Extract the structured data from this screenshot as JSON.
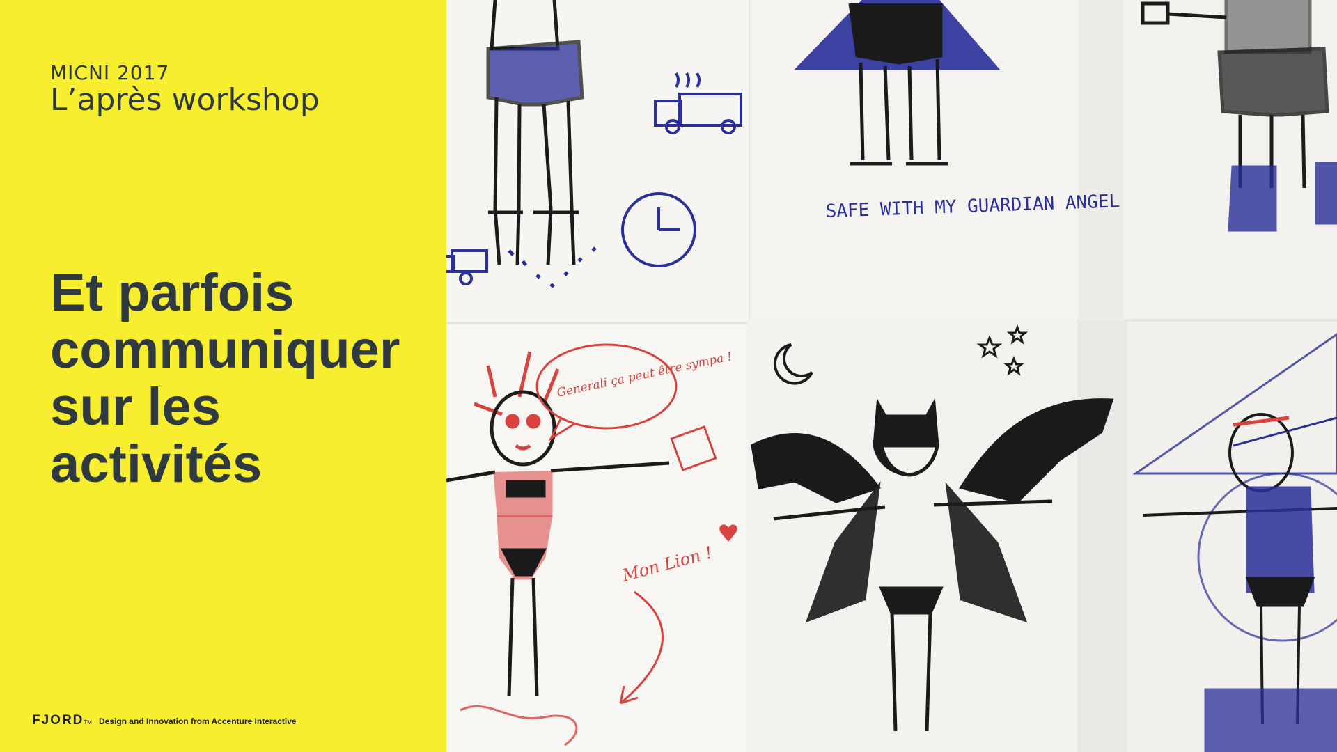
{
  "slide": {
    "event": "MICNI 2017",
    "subtitle": "L’après workshop",
    "headline_lines": [
      "Et parfois",
      "communiquer",
      "sur les",
      "activités"
    ],
    "footer_brand": "FJORD",
    "footer_tagline": "Design and Innovation from Accenture Interactive"
  },
  "photo": {
    "sketch_text_safe": "SAFE WITH MY GUARDIAN ANGEL",
    "sketch_text_speech": "Generali ça peut être sympa !",
    "sketch_text_lion": "Mon Lion !"
  },
  "colors": {
    "panel_yellow": "#f7ee30",
    "text_dark": "#2f3a40",
    "ink_blue": "#2a2f9a",
    "ink_red": "#d8423f",
    "ink_black": "#1b1b1b"
  }
}
